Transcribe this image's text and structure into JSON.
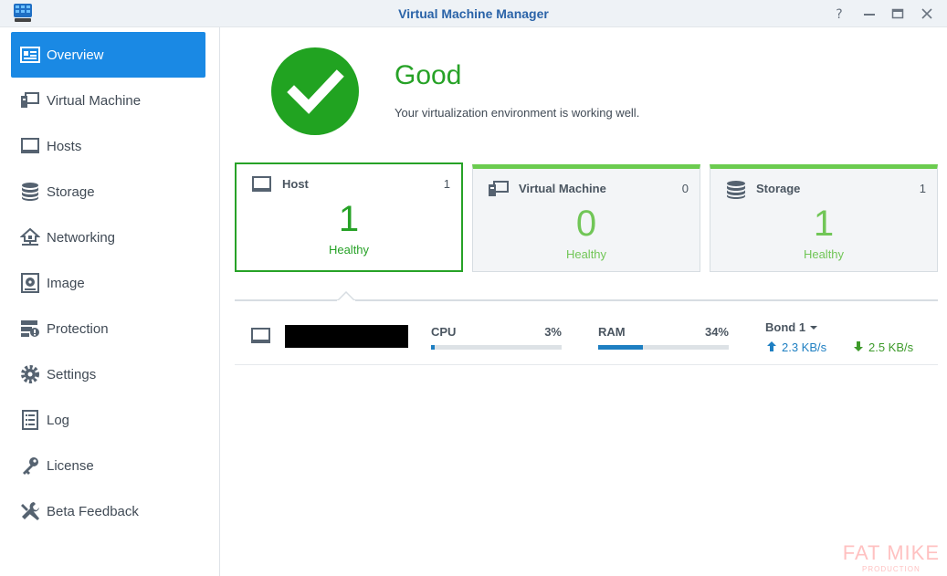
{
  "window": {
    "title": "Virtual Machine Manager",
    "controls": [
      "help-icon",
      "minimize-icon",
      "maximize-icon",
      "close-icon"
    ]
  },
  "sidebar": {
    "items": [
      {
        "label": "Overview",
        "icon": "overview-icon",
        "active": true
      },
      {
        "label": "Virtual Machine",
        "icon": "virtual-machine-icon"
      },
      {
        "label": "Hosts",
        "icon": "monitor-icon"
      },
      {
        "label": "Storage",
        "icon": "database-icon"
      },
      {
        "label": "Networking",
        "icon": "network-icon"
      },
      {
        "label": "Image",
        "icon": "disc-icon"
      },
      {
        "label": "Protection",
        "icon": "protection-icon"
      },
      {
        "label": "Settings",
        "icon": "gear-icon"
      },
      {
        "label": "Log",
        "icon": "log-icon"
      },
      {
        "label": "License",
        "icon": "key-icon"
      },
      {
        "label": "Beta Feedback",
        "icon": "tools-icon"
      }
    ]
  },
  "status": {
    "title": "Good",
    "description": "Your virtualization environment is working well."
  },
  "cards": [
    {
      "title": "Host",
      "count": "1",
      "value": "1",
      "status": "Healthy",
      "selected": true
    },
    {
      "title": "Virtual Machine",
      "count": "0",
      "value": "0",
      "status": "Healthy"
    },
    {
      "title": "Storage",
      "count": "1",
      "value": "1",
      "status": "Healthy"
    }
  ],
  "host_row": {
    "cpu_label": "CPU",
    "cpu_value": "3%",
    "cpu_percent": 3,
    "ram_label": "RAM",
    "ram_value": "34%",
    "ram_percent": 34,
    "bond_label": "Bond 1",
    "upload": "2.3 KB/s",
    "download": "2.5 KB/s"
  },
  "watermark": {
    "main": "FAT MIKE",
    "sub": "PRODUCTION"
  },
  "colors": {
    "accent": "#1a89e4",
    "good": "#27a227",
    "healthy_light": "#71c657",
    "bar": "#1e7fc2",
    "upload": "#1e7fc2",
    "download": "#3d9a2a"
  }
}
